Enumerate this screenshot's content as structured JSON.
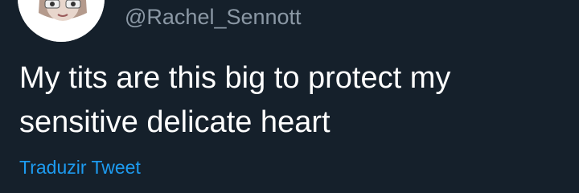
{
  "tweet": {
    "handle": "@Rachel_Sennott",
    "text": "My tits are this big to protect my sensitive delicate heart",
    "translate_label": "Traduzir Tweet"
  },
  "colors": {
    "background": "#15202b",
    "text": "#ffffff",
    "secondary_text": "#8b98a5",
    "link": "#1d9bf0"
  }
}
